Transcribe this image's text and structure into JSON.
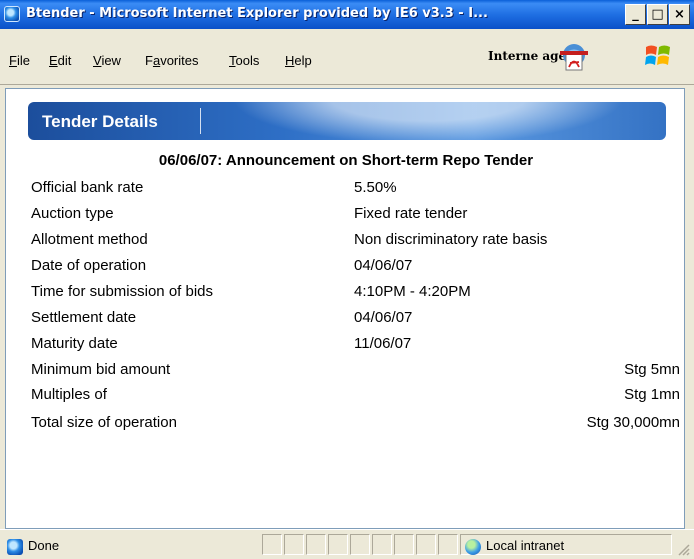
{
  "window": {
    "title": "Btender - Microsoft Internet Explorer provided by IE6 v3.3 - I...",
    "minimize_glyph": "_",
    "maximize_glyph": "□",
    "close_glyph": "×"
  },
  "menubar": {
    "items": [
      {
        "accel": "F",
        "rest": "ile"
      },
      {
        "accel": "E",
        "rest": "dit"
      },
      {
        "accel": "V",
        "rest": "iew"
      },
      {
        "pre": "F",
        "accel": "a",
        "rest": "vorites"
      },
      {
        "accel": "T",
        "rest": "ools"
      },
      {
        "accel": "H",
        "rest": "elp"
      }
    ],
    "extension_text": "Interne   age i"
  },
  "page": {
    "banner_title": "Tender Details",
    "heading": "06/06/07: Announcement on Short-term Repo Tender",
    "rows": [
      {
        "label": "Official bank rate",
        "value": "5.50%"
      },
      {
        "label": "Auction type",
        "value": "Fixed rate tender"
      },
      {
        "label": "Allotment method",
        "value": "Non discriminatory rate basis"
      },
      {
        "label": "Date of operation",
        "value": "04/06/07"
      },
      {
        "label": "Time for submission of bids",
        "value": "4:10PM - 4:20PM"
      },
      {
        "label": "Settlement date",
        "value": "04/06/07"
      },
      {
        "label": "Maturity date",
        "value": "11/06/07"
      },
      {
        "label": "Minimum bid amount",
        "value": "Stg 5mn"
      },
      {
        "label": "Multiples of",
        "value": "Stg 1mn"
      },
      {
        "label": "Total size of operation",
        "value": "Stg 30,000mn"
      }
    ]
  },
  "statusbar": {
    "status": "Done",
    "zone": "Local intranet"
  },
  "colors": {
    "title_bar": "#0a5fd8",
    "banner": "#2e6fc6",
    "chrome": "#ece9d8"
  }
}
